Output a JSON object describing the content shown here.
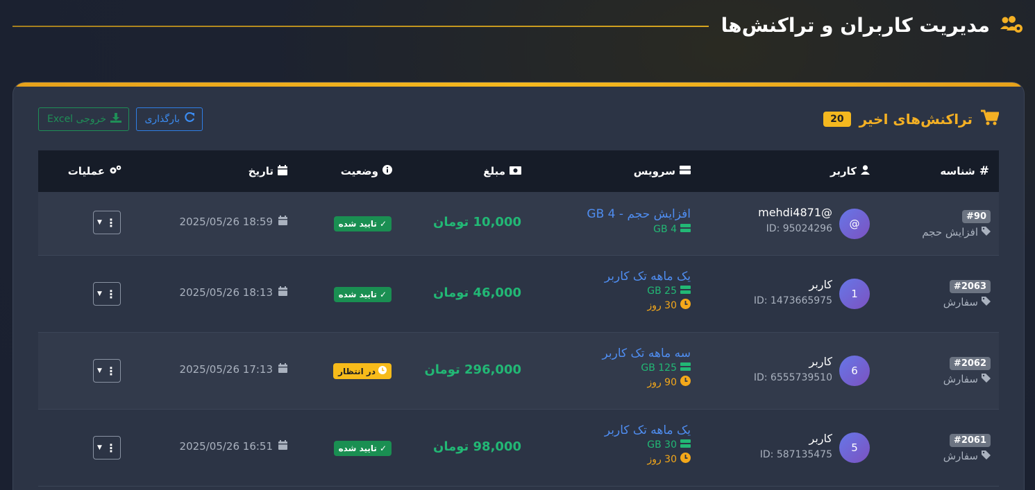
{
  "page": {
    "title": "مدیریت کاربران و تراکنش‌ها"
  },
  "card": {
    "title": "تراکنش‌های اخیر",
    "count": "20",
    "reload_label": "بارگذاری",
    "excel_label": "خروجی Excel"
  },
  "table": {
    "headers": {
      "id": "شناسه",
      "user": "کاربر",
      "service": "سرویس",
      "amount": "مبلغ",
      "status": "وضعیت",
      "date": "تاریخ",
      "actions": "عملیات"
    },
    "rows": [
      {
        "id": "#90",
        "type": "افزایش حجم",
        "avatar": "@",
        "user_name": "mehdi4871@",
        "user_id": "ID: 95024296",
        "service": "افزایش حجم - 4 GB",
        "gb": "4 GB",
        "days": "",
        "amount": "10,000 تومان",
        "status": "تایید شده",
        "status_kind": "ok",
        "date": "2025/05/26 18:59"
      },
      {
        "id": "#2063",
        "type": "سفارش",
        "avatar": "1",
        "user_name": "کاربر",
        "user_id": "ID: 1473665975",
        "service": "یک ماهه تک کاربر",
        "gb": "25 GB",
        "days": "30 روز",
        "amount": "46,000 تومان",
        "status": "تایید شده",
        "status_kind": "ok",
        "date": "2025/05/26 18:13"
      },
      {
        "id": "#2062",
        "type": "سفارش",
        "avatar": "6",
        "user_name": "کاربر",
        "user_id": "ID: 6555739510",
        "service": "سه ماهه تک کاربر",
        "gb": "125 GB",
        "days": "90 روز",
        "amount": "296,000 تومان",
        "status": "در انتظار",
        "status_kind": "wait",
        "date": "2025/05/26 17:13"
      },
      {
        "id": "#2061",
        "type": "سفارش",
        "avatar": "5",
        "user_name": "کاربر",
        "user_id": "ID: 587135475",
        "service": "یک ماهه تک کاربر",
        "gb": "30 GB",
        "days": "30 روز",
        "amount": "98,000 تومان",
        "status": "تایید شده",
        "status_kind": "ok",
        "date": "2025/05/26 16:51"
      }
    ]
  },
  "colors": {
    "accent": "#f4b024",
    "success": "#22b875",
    "link": "#4f8df0",
    "warning": "#f7bb1a"
  },
  "icons": [
    "users-cog-icon",
    "cart-icon",
    "reload-icon",
    "download-icon",
    "hash-icon",
    "user-icon",
    "server-icon",
    "money-icon",
    "info-icon",
    "calendar-icon",
    "cogs-icon",
    "tag-icon",
    "check-icon",
    "clock-icon",
    "dots-icon",
    "caret-down-icon"
  ]
}
